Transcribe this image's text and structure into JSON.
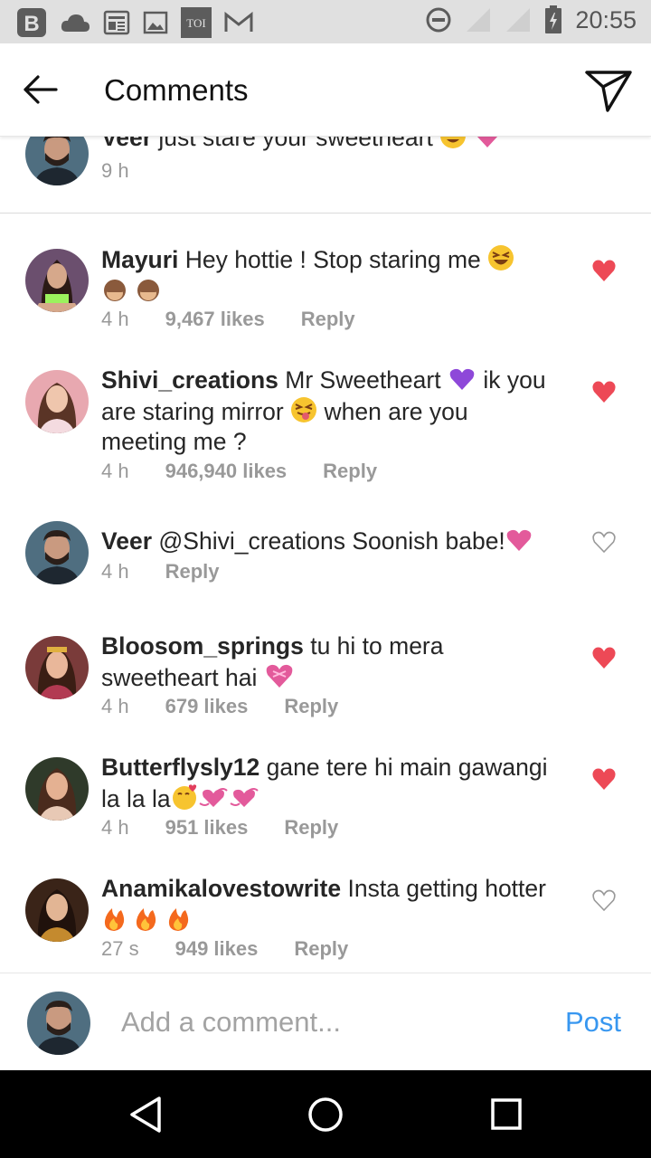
{
  "status_bar": {
    "time": "20:55",
    "toi_label": "TOI",
    "blogger_label": "B",
    "icons": [
      "blogger-icon",
      "cloud-icon",
      "news-icon",
      "image-icon",
      "toi-icon",
      "gmail-icon",
      "dnd-icon",
      "signal-icon",
      "signal-icon",
      "battery-icon"
    ]
  },
  "header": {
    "title": "Comments",
    "back_icon": "arrow-left-icon",
    "share_icon": "send-icon"
  },
  "caption": {
    "user": "Veer",
    "text": "just stare your sweetheart",
    "time": "9 h",
    "emojis": [
      "heart-eyes",
      "pink-heart"
    ]
  },
  "comments": [
    {
      "user": "Mayuri",
      "text": "Hey hottie ! Stop staring me",
      "time": "4 h",
      "likes": "9,467 likes",
      "reply": "Reply",
      "liked": true
    },
    {
      "user": "Shivi_creations",
      "text1": "Mr Sweetheart",
      "text2": "ik you are staring mirror",
      "text3": "when are you meeting me ?",
      "time": "4 h",
      "likes": "946,940 likes",
      "reply": "Reply",
      "liked": true
    },
    {
      "user": "Veer",
      "text": "@Shivi_creations Soonish babe!",
      "time": "4 h",
      "reply": "Reply",
      "liked": false
    },
    {
      "user": "Bloosom_springs",
      "text": "tu hi to mera sweetheart hai",
      "time": "4 h",
      "likes": "679 likes",
      "reply": "Reply",
      "liked": true
    },
    {
      "user": "Butterflysly12",
      "text": "gane tere hi main gawangi la la la",
      "time": "4 h",
      "likes": "951 likes",
      "reply": "Reply",
      "liked": true
    },
    {
      "user": "Anamikalovestowrite",
      "text": "Insta getting hotter",
      "time": "27 s",
      "likes": "949 likes",
      "reply": "Reply",
      "liked": false
    }
  ],
  "composer": {
    "placeholder": "Add a comment...",
    "post_label": "Post"
  },
  "colors": {
    "heart_red": "#ed4956",
    "post_blue": "#3897f0",
    "status_bg": "#e0e0e0"
  }
}
